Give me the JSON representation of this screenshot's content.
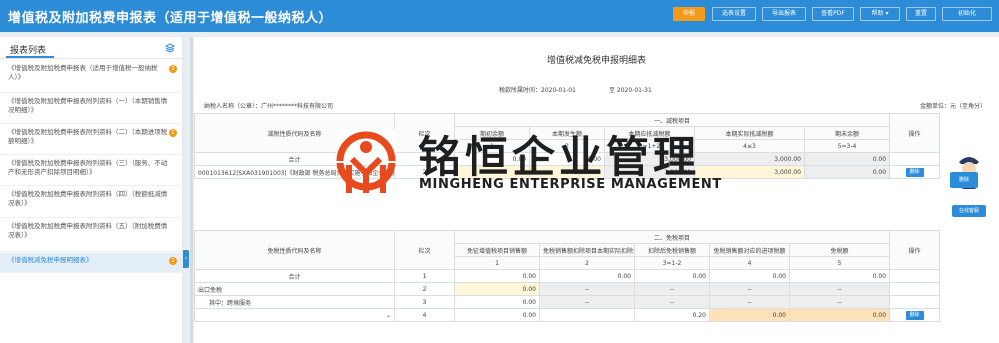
{
  "app": {
    "title": "增值税及附加税费申报表（适用于增值税一般纳税人）"
  },
  "toolbar": {
    "buttons": [
      "申报",
      "选表设置",
      "导出报表",
      "查看PDF",
      "帮助",
      "重置",
      "初始化"
    ],
    "primary_color": "#f39a1b",
    "bar_color": "#2d8cd8"
  },
  "sidebar": {
    "title": "报表列表",
    "items": [
      {
        "label": "《增值税及附加税费申报表（适用于增值税一般纳税人）》",
        "badge": "2"
      },
      {
        "label": "《增值税及附加税费申报表附列资料（一）（本期销售情况明细）》",
        "badge": ""
      },
      {
        "label": "《增值税及附加税费申报表附列资料（二）（本期进项税额明细）》",
        "badge": "1"
      },
      {
        "label": "《增值税及附加税费申报表附列资料（三）（服务、不动产和无形资产扣除项目明细）》",
        "badge": ""
      },
      {
        "label": "《增值税及附加税费申报表附列资料（四）（税额抵减情况表）》",
        "badge": ""
      },
      {
        "label": "《增值税及附加税费申报表附列资料（五）（附加税费情况表）》",
        "badge": ""
      },
      {
        "label": "《增值税减免税申报明细表》",
        "badge": "2"
      }
    ],
    "collapse_glyph": "‹"
  },
  "report": {
    "title": "增值税减免税申报明细表",
    "period_label": "税款所属时间：2020-01-01",
    "period_to": "至 2020-01-31",
    "taxpayer": "纳税人名称（公章）：广州********科技有限公司",
    "unit": "金额单位：元（至角分）"
  },
  "section1": {
    "title": "一、减税项目",
    "headers": [
      "减税性质代码及名称",
      "栏次",
      "期初余额",
      "本期发生额",
      "本期应抵减税额",
      "本期实际抵减税额",
      "期末余额",
      "操作"
    ],
    "subcols": [
      "1",
      "2",
      "3=1+2",
      "4≤3",
      "5=3-4"
    ],
    "rows": [
      {
        "name": "合计",
        "line": "1",
        "v1": "0.00",
        "v2": "0.00",
        "v3": "3,000.00",
        "v4": "3,000.00",
        "v5": "0.00"
      },
      {
        "name": "0001013612|SXA031901003|《财政部 税务总局关于实施小微企业普惠性税收减免政策的通知》",
        "line": "2",
        "v1": "",
        "v2": "3,000.00",
        "v3": "3,000.00",
        "v4": "3,000.00",
        "v5": "0.00",
        "op": "删除"
      }
    ]
  },
  "section2": {
    "title": "二、免税项目",
    "headers": [
      "免税性质代码及名称",
      "栏次",
      "免征增值税项目销售额",
      "免税销售额扣除项目本期实际扣除金额",
      "扣除后免税销售额",
      "免税销售额对应的进项税额",
      "免税额",
      "操作"
    ],
    "subcols": [
      "1",
      "2",
      "3=1-2",
      "4",
      "5"
    ],
    "rows": [
      {
        "name": "合计",
        "line": "1",
        "v1": "0.00",
        "v2": "0.00",
        "v3": "0.00",
        "v4": "0.00",
        "v5": "0.00"
      },
      {
        "name": "出口免税",
        "line": "2",
        "v1": "0.00",
        "v2": "--",
        "v3": "--",
        "v4": "--",
        "v5": "--"
      },
      {
        "name": "其中：跨境服务",
        "line": "3",
        "v1": "0.00",
        "v2": "--",
        "v3": "--",
        "v4": "--",
        "v5": "--"
      },
      {
        "name": "",
        "line": "4",
        "v1": "0.00",
        "v2": "",
        "v3": "0.20",
        "v4": "0.00",
        "v5": "0.00",
        "op": "删除"
      }
    ]
  },
  "assistant": {
    "btn1": "删除",
    "btn2": "在线客服"
  },
  "watermark": {
    "cn": "铭恒企业管理",
    "en": "MINGHENG ENTERPRISE MANAGEMENT"
  }
}
